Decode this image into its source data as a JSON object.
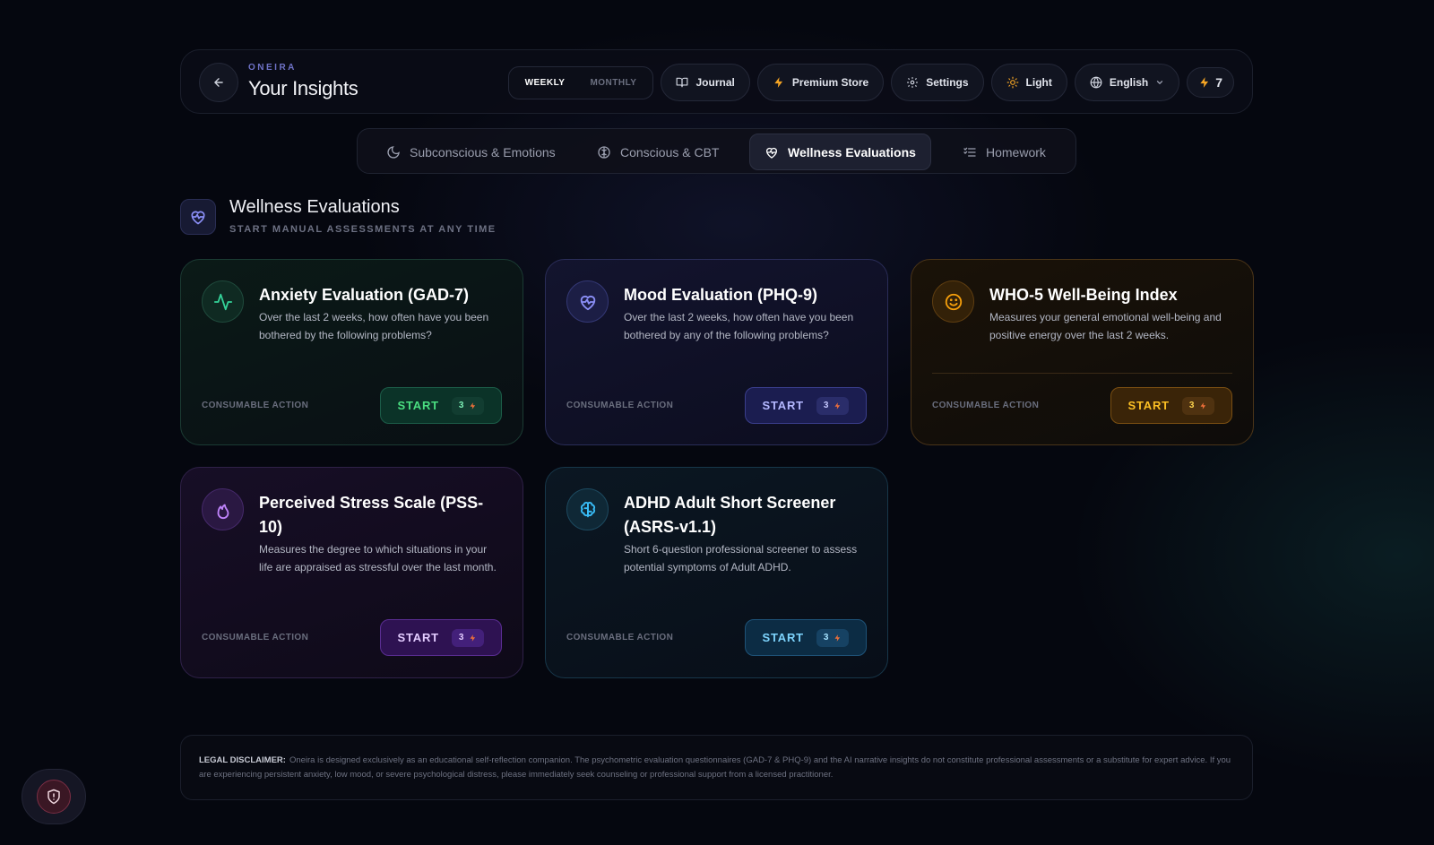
{
  "header": {
    "brand": "ONEIRA",
    "title": "Your Insights",
    "period": {
      "weekly": "WEEKLY",
      "monthly": "MONTHLY",
      "selected": "WEEKLY"
    },
    "journal_label": "Journal",
    "premium_label": "Premium Store",
    "settings_label": "Settings",
    "theme_label": "Light",
    "language_label": "English",
    "energy_count": "7"
  },
  "tabs": [
    {
      "label": "Subconscious & Emotions",
      "icon": "moon-icon",
      "active": false
    },
    {
      "label": "Conscious & CBT",
      "icon": "brain-icon",
      "active": false
    },
    {
      "label": "Wellness Evaluations",
      "icon": "heart-pulse-icon",
      "active": true
    },
    {
      "label": "Homework",
      "icon": "checklist-icon",
      "active": false
    }
  ],
  "section": {
    "title": "Wellness Evaluations",
    "subtitle": "START MANUAL ASSESSMENTS AT ANY TIME"
  },
  "cards": [
    {
      "title": "Anxiety Evaluation (GAD-7)",
      "description": "Over the last 2 weeks, how often have you been bothered by the following problems?",
      "footer_label": "CONSUMABLE ACTION",
      "button_label": "START",
      "cost": "3",
      "icon": "activity-icon",
      "accent": "#34d399"
    },
    {
      "title": "Mood Evaluation (PHQ-9)",
      "description": "Over the last 2 weeks, how often have you been bothered by any of the following problems?",
      "footer_label": "CONSUMABLE ACTION",
      "button_label": "START",
      "cost": "3",
      "icon": "heart-pulse-icon",
      "accent": "#8b8ff7"
    },
    {
      "title": "WHO-5 Well-Being Index",
      "description": "Measures your general emotional well-being and positive energy over the last 2 weeks.",
      "footer_label": "CONSUMABLE ACTION",
      "button_label": "START",
      "cost": "3",
      "icon": "smile-icon",
      "accent": "#f59e0b"
    },
    {
      "title": "Perceived Stress Scale (PSS-10)",
      "description": "Measures the degree to which situations in your life are appraised as stressful over the last month.",
      "footer_label": "CONSUMABLE ACTION",
      "button_label": "START",
      "cost": "3",
      "icon": "flame-icon",
      "accent": "#c084fc"
    },
    {
      "title": "ADHD Adult Short Screener (ASRS-v1.1)",
      "description": "Short 6-question professional screener to assess potential symptoms of Adult ADHD.",
      "footer_label": "CONSUMABLE ACTION",
      "button_label": "START",
      "cost": "3",
      "icon": "brain-icon",
      "accent": "#38bdf8"
    }
  ],
  "disclaimer": {
    "label": "LEGAL DISCLAIMER:",
    "text": "Oneira is designed exclusively as an educational self-reflection companion. The psychometric evaluation questionnaires (GAD-7 & PHQ-9) and the AI narrative insights do not constitute professional assessments or a substitute for expert advice. If you are experiencing persistent anxiety, low mood, or severe psychological distress, please immediately seek counseling or professional support from a licensed practitioner."
  }
}
